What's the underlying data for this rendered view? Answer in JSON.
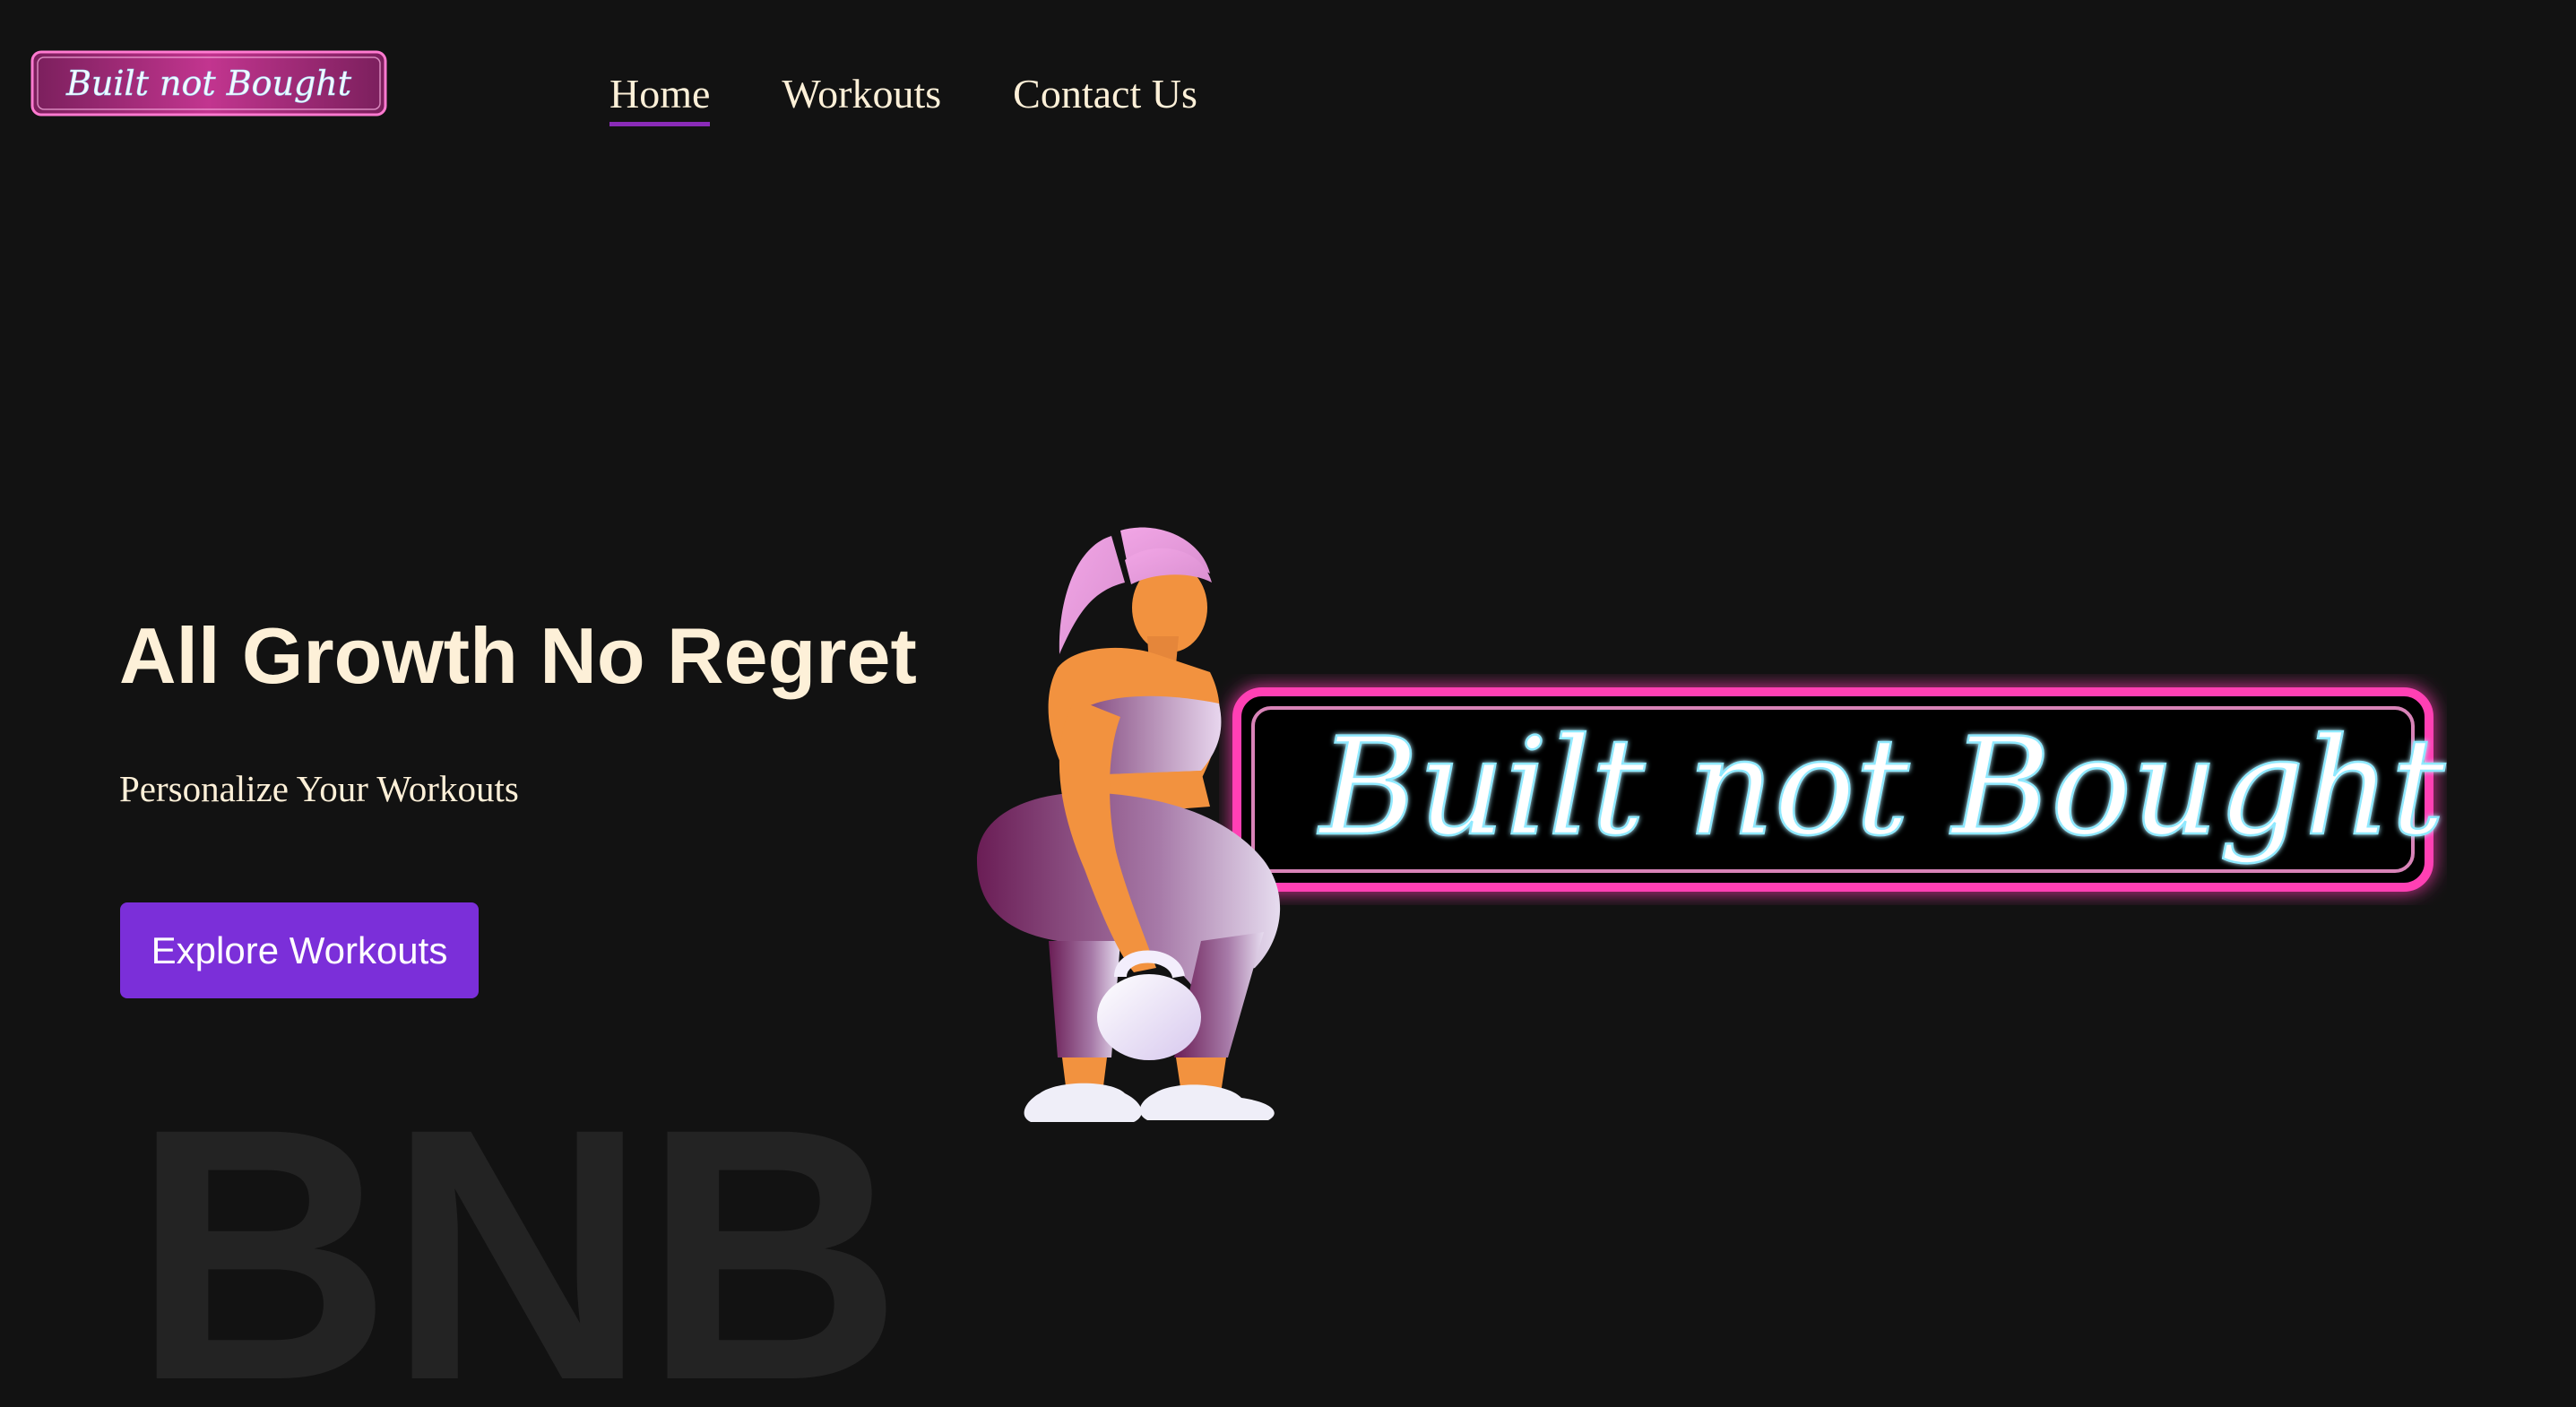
{
  "brand": {
    "logo_text": "Built not Bought",
    "logo_icon": "brand-logo-icon"
  },
  "nav": {
    "items": [
      {
        "label": "Home",
        "active": true
      },
      {
        "label": "Workouts",
        "active": false
      },
      {
        "label": "Contact Us",
        "active": false
      }
    ]
  },
  "hero": {
    "title": "All Growth No Regret",
    "subtitle": "Personalize Your Workouts",
    "cta_label": "Explore Workouts",
    "watermark": "BNB",
    "sign_text": "Built not Bought",
    "illustration_icon": "kettlebell-woman-illustration"
  },
  "colors": {
    "background": "#121212",
    "text": "#fdf0d8",
    "accent_purple": "#7b2fd9",
    "nav_underline": "#8a2bb8",
    "neon_pink": "#ff3fb4",
    "neon_text": "#e8fbff",
    "watermark": "#232323"
  }
}
